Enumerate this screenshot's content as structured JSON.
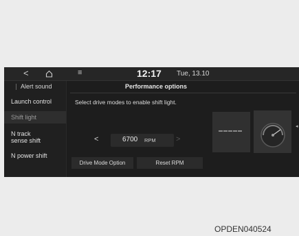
{
  "topbar": {
    "back_glyph": "<",
    "menu_glyph": "≡",
    "time": "12:17",
    "date": "Tue, 13.10"
  },
  "sidebar": {
    "title": "Alert sound",
    "items": [
      {
        "label": "Launch control"
      },
      {
        "label": "Shift light",
        "selected": true
      },
      {
        "label": "N track sense shift"
      },
      {
        "label": "N power shift"
      }
    ]
  },
  "main": {
    "title": "Performance options",
    "instruction": "Select drive modes to enable shift light.",
    "rpm": {
      "value": "6700",
      "unit": "RPM",
      "prev": "<",
      "next": ">"
    },
    "buttons": {
      "drive_mode_option": "Drive Mode Option",
      "reset_rpm": "Reset RPM"
    },
    "pager_glyph": "◂"
  },
  "icons": [
    "back-icon",
    "home-icon",
    "menu-icon",
    "tachometer-icon",
    "shift-light-bar-icon"
  ],
  "caption": "OPDEN040524"
}
